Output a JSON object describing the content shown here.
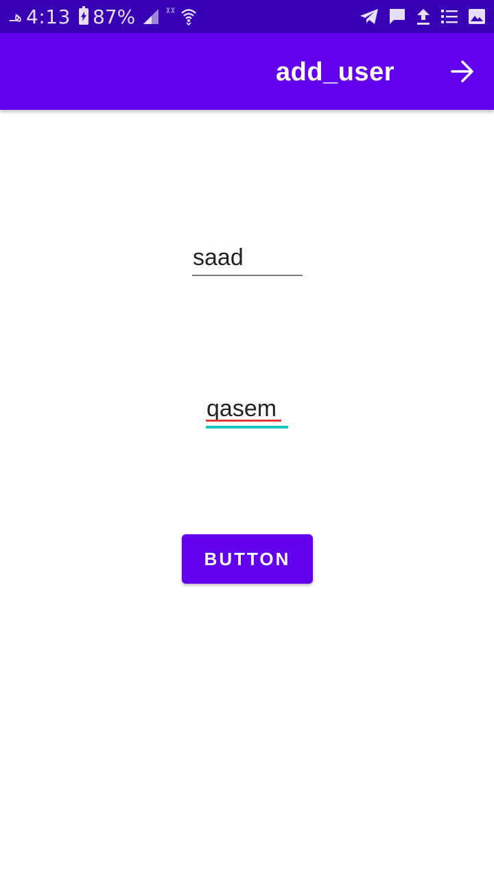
{
  "status_bar": {
    "carrier_glyph": "هـ",
    "time": "4:13",
    "battery_percent": "87%",
    "icons": [
      "signal-icon",
      "no-data-icon",
      "wifi-icon",
      "telegram-icon",
      "message-icon",
      "upload-icon",
      "list-icon",
      "image-icon"
    ]
  },
  "app_bar": {
    "title": "add_user",
    "action_icon": "arrow-forward-icon"
  },
  "form": {
    "first_name_value": "saad",
    "last_name_value": "qasem",
    "button_label": "BUTTON"
  },
  "colors": {
    "status_bar": "#3700B3",
    "primary": "#6200EE",
    "accent": "#16C7C0",
    "spellcheck": "#E53935"
  }
}
